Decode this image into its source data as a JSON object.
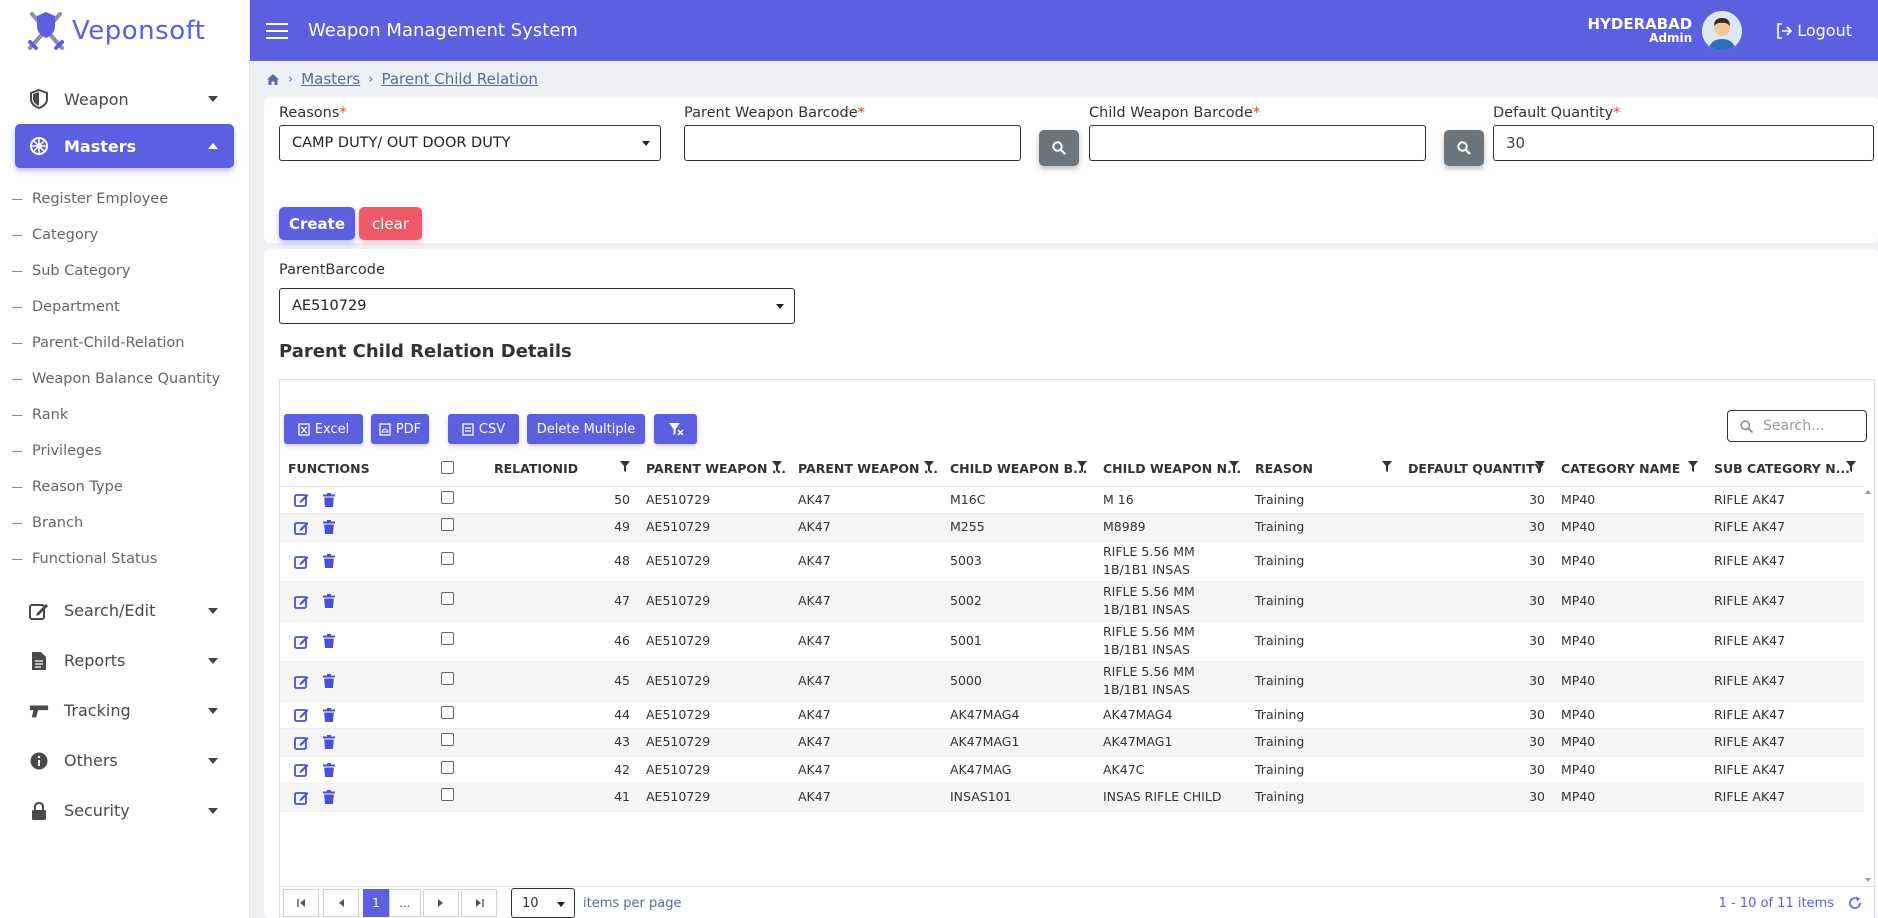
{
  "brand": {
    "name": "Veponsoft",
    "accent": "#5b5fe0"
  },
  "header": {
    "title": "Weapon Management System",
    "city": "HYDERABAD",
    "role": "Admin",
    "logout": "Logout"
  },
  "sidebar": {
    "top_items": [
      {
        "label": "Weapon",
        "icon": "shield-icon"
      },
      {
        "label": "Masters",
        "icon": "dharma-wheel-icon",
        "active": true
      }
    ],
    "sub_items": [
      "Register Employee",
      "Category",
      "Sub Category",
      "Department",
      "Parent-Child-Relation",
      "Weapon Balance Quantity",
      "Rank",
      "Privileges",
      "Reason Type",
      "Branch",
      "Functional Status"
    ],
    "bottom_items": [
      {
        "label": "Search/Edit",
        "icon": "edit-icon"
      },
      {
        "label": "Reports",
        "icon": "file-icon"
      },
      {
        "label": "Tracking",
        "icon": "gun-icon"
      },
      {
        "label": "Others",
        "icon": "info-icon"
      },
      {
        "label": "Security",
        "icon": "lock-icon"
      }
    ]
  },
  "breadcrumb": {
    "masters": "Masters",
    "current": "Parent Child Relation"
  },
  "form": {
    "reasons_label": "Reasons",
    "reasons_value": "CAMP DUTY/ OUT DOOR DUTY",
    "parent_label": "Parent Weapon Barcode",
    "parent_value": "",
    "child_label": "Child Weapon Barcode",
    "child_value": "",
    "qty_label": "Default Quantity",
    "qty_value": "30",
    "required_mark": "*",
    "create": "Create",
    "clear": "clear"
  },
  "filter": {
    "label": "ParentBarcode",
    "value": "AE510729"
  },
  "grid": {
    "title": "Parent Child Relation Details",
    "toolbar": {
      "excel": "Excel",
      "pdf": "PDF",
      "csv": "CSV",
      "delete_multiple": "Delete Multiple"
    },
    "search_placeholder": "Search...",
    "columns": [
      "FUNCTIONS",
      "",
      "RELATIONID",
      "PARENT WEAPON ...",
      "PARENT WEAPON ...",
      "CHILD WEAPON B...",
      "CHILD WEAPON N...",
      "REASON",
      "DEFAULT QUANTITY",
      "CATEGORY NAME",
      "SUB CATEGORY N..."
    ],
    "rows": [
      [
        "50",
        "AE510729",
        "AK47",
        "M16C",
        "M 16",
        "Training",
        "30",
        "MP40",
        "RIFLE AK47"
      ],
      [
        "49",
        "AE510729",
        "AK47",
        "M255",
        "M8989",
        "Training",
        "30",
        "MP40",
        "RIFLE AK47"
      ],
      [
        "48",
        "AE510729",
        "AK47",
        "5003",
        "RIFLE 5.56 MM 1B/1B1 INSAS",
        "Training",
        "30",
        "MP40",
        "RIFLE AK47"
      ],
      [
        "47",
        "AE510729",
        "AK47",
        "5002",
        "RIFLE 5.56 MM 1B/1B1 INSAS",
        "Training",
        "30",
        "MP40",
        "RIFLE AK47"
      ],
      [
        "46",
        "AE510729",
        "AK47",
        "5001",
        "RIFLE 5.56 MM 1B/1B1 INSAS",
        "Training",
        "30",
        "MP40",
        "RIFLE AK47"
      ],
      [
        "45",
        "AE510729",
        "AK47",
        "5000",
        "RIFLE 5.56 MM 1B/1B1 INSAS",
        "Training",
        "30",
        "MP40",
        "RIFLE AK47"
      ],
      [
        "44",
        "AE510729",
        "AK47",
        "AK47MAG4",
        "AK47MAG4",
        "Training",
        "30",
        "MP40",
        "RIFLE AK47"
      ],
      [
        "43",
        "AE510729",
        "AK47",
        "AK47MAG1",
        "AK47MAG1",
        "Training",
        "30",
        "MP40",
        "RIFLE AK47"
      ],
      [
        "42",
        "AE510729",
        "AK47",
        "AK47MAG",
        "AK47C",
        "Training",
        "30",
        "MP40",
        "RIFLE AK47"
      ],
      [
        "41",
        "AE510729",
        "AK47",
        "INSAS101",
        "INSAS RIFLE CHILD",
        "Training",
        "30",
        "MP40",
        "RIFLE AK47"
      ]
    ],
    "pager": {
      "current_page": "1",
      "ellipsis": "...",
      "page_size": "10",
      "items_per_page": "items per page",
      "info": "1 - 10 of 11 items"
    }
  }
}
